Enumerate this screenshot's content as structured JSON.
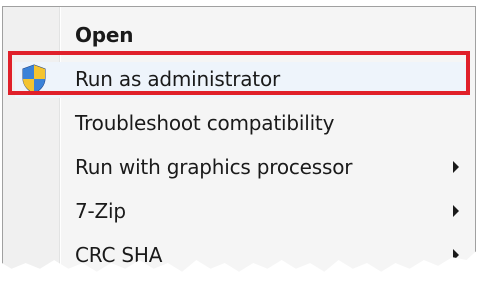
{
  "menu": {
    "items": [
      {
        "label": "Open",
        "bold": true,
        "submenu": false,
        "icon": ""
      },
      {
        "label": "Run as administrator",
        "bold": false,
        "submenu": false,
        "icon": "uac-shield-icon"
      },
      {
        "label": "Troubleshoot compatibility",
        "bold": false,
        "submenu": false,
        "icon": ""
      },
      {
        "label": "Run with graphics processor",
        "bold": false,
        "submenu": true,
        "icon": ""
      },
      {
        "label": "7-Zip",
        "bold": false,
        "submenu": true,
        "icon": ""
      },
      {
        "label": "CRC SHA",
        "bold": false,
        "submenu": true,
        "icon": ""
      }
    ],
    "highlighted_item": "Run as administrator",
    "highlight_color": "#e0202a"
  }
}
